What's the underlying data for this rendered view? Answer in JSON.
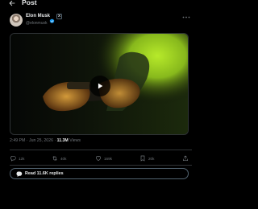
{
  "header": {
    "title": "Post",
    "back_icon": "arrow-left-icon"
  },
  "author": {
    "display_name": "Elon Musk",
    "handle": "@elonmusk",
    "verified_color": "#1d9bf0",
    "affiliate_badge": "X",
    "more_icon": "more-horizontal-icon"
  },
  "media": {
    "type": "video",
    "play_icon": "play-icon"
  },
  "meta": {
    "time": "2:49 PM",
    "separator": "·",
    "date": "Jun 25, 2026",
    "views_count": "11.3M",
    "views_label": "Views"
  },
  "actions": {
    "replies": "12k",
    "reposts": "40k",
    "likes": "169k",
    "bookmarks": "20k",
    "share_icon": "share-icon"
  },
  "replies_button": {
    "label": "Read 11.6K replies"
  },
  "colors": {
    "background": "#000000",
    "text": "#e7e9ea",
    "muted": "#71767b",
    "border": "#2f3336",
    "accent": "#1d9bf0"
  }
}
